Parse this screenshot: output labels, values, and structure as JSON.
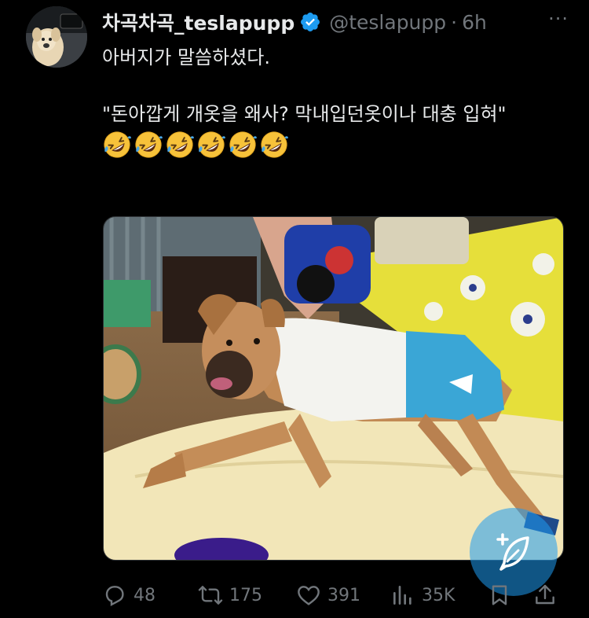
{
  "author": {
    "display_name": "차곡차곡_teslapupp",
    "handle": "@teslapupp",
    "separator": "·",
    "time": "6h",
    "more_glyph": "···",
    "verified": true
  },
  "tweet": {
    "line1": "아버지가 말씀하셨다.",
    "line2": "\"돈아깝게 개옷을 왜사?  막내입던옷이나 대충 입혀\"",
    "emoji": "rolling-on-the-floor-laughing",
    "emoji_count": 6
  },
  "media": {
    "icon": "photo"
  },
  "actions": {
    "replies": "48",
    "retweets": "175",
    "likes": "391",
    "views": "35K"
  },
  "colors": {
    "background": "#000000",
    "text": "#e7e9ea",
    "muted": "#71767b",
    "accent": "#1d9bf0"
  }
}
